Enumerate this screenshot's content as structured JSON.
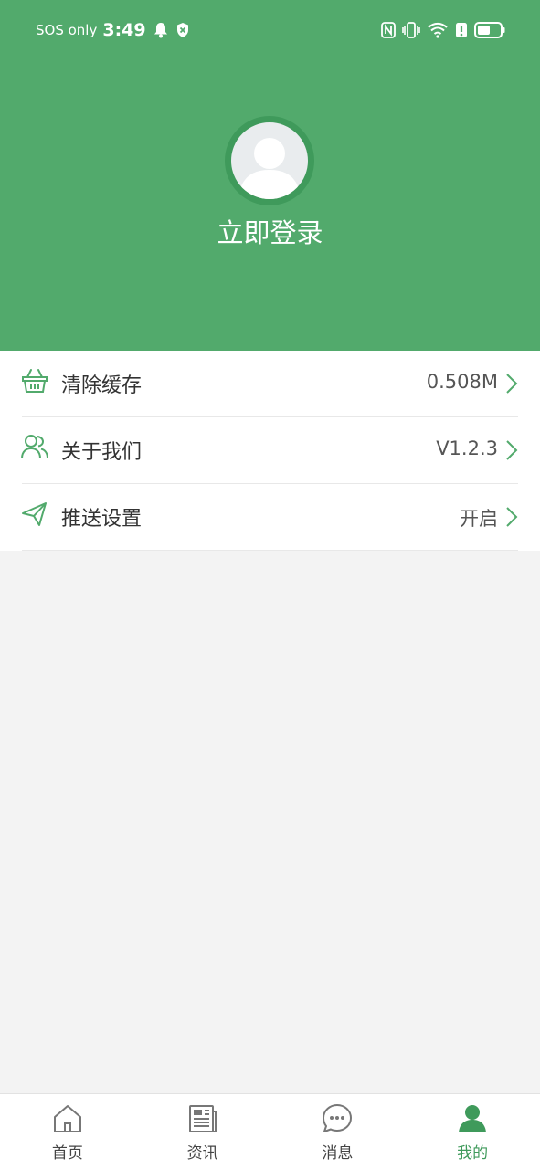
{
  "status_bar": {
    "carrier": "SOS only",
    "time": "3:49"
  },
  "profile": {
    "login_label": "立即登录"
  },
  "menu": {
    "items": [
      {
        "label": "清除缓存",
        "value": "0.508M",
        "icon": "basket-icon"
      },
      {
        "label": "关于我们",
        "value": "V1.2.3",
        "icon": "users-icon"
      },
      {
        "label": "推送设置",
        "value": "开启",
        "icon": "send-icon"
      }
    ]
  },
  "tabbar": {
    "tabs": [
      {
        "label": "首页",
        "icon": "home-icon"
      },
      {
        "label": "资讯",
        "icon": "news-icon"
      },
      {
        "label": "消息",
        "icon": "chat-icon"
      },
      {
        "label": "我的",
        "icon": "person-icon",
        "active": true
      }
    ]
  },
  "colors": {
    "accent": "#52aa6c",
    "accent_dark": "#3f9a5b",
    "background": "#f3f3f3"
  }
}
